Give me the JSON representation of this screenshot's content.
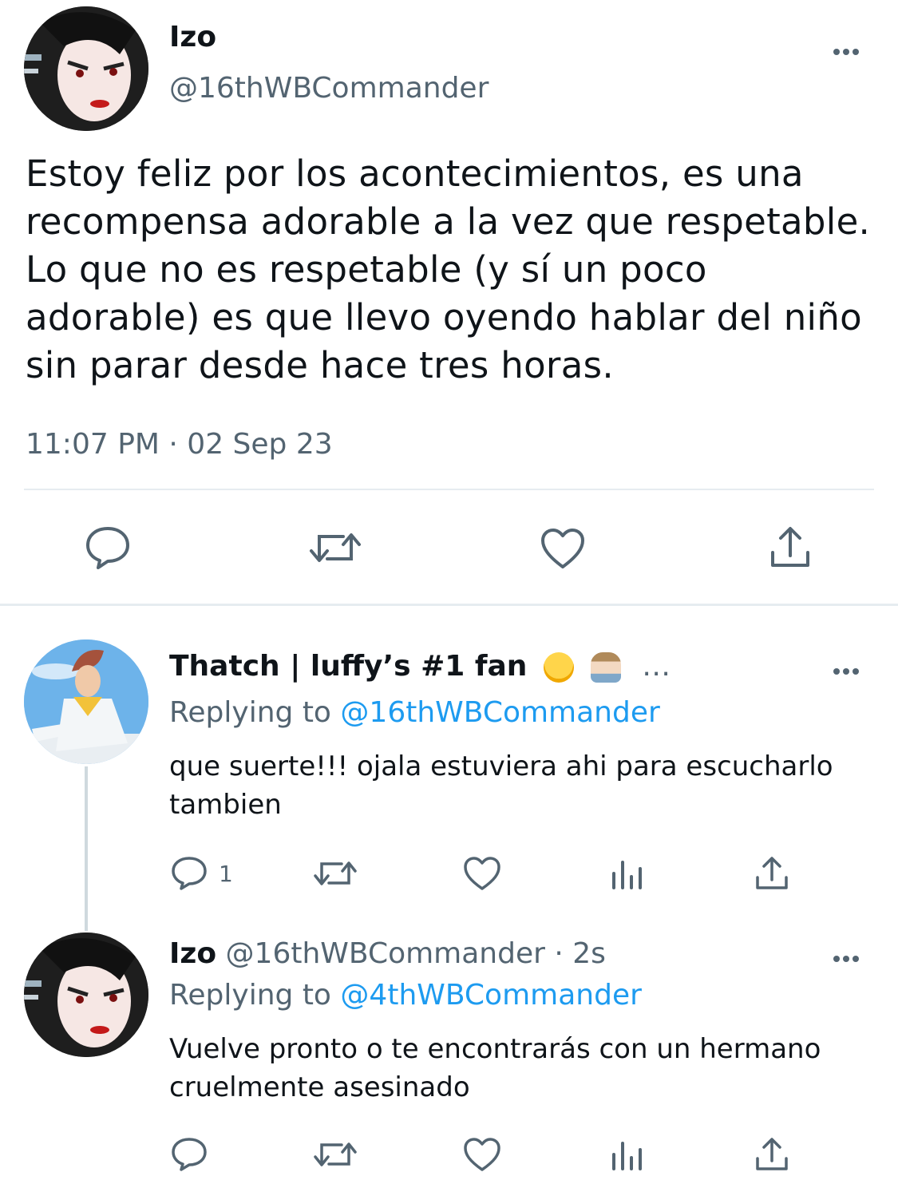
{
  "main_tweet": {
    "author_name": "Izo",
    "author_handle": "@16thWBCommander",
    "text": "Estoy feliz por los acontecimientos, es una recompensa adorable a la vez que respetable. Lo que no es respetable (y sí un poco adorable) es que llevo oyendo hablar del niño sin parar desde hace tres horas.",
    "timestamp": "11:07 PM · 02 Sep 23",
    "icons": [
      "reply-icon",
      "retweet-icon",
      "like-icon",
      "share-icon"
    ]
  },
  "replies": [
    {
      "author_name": "Thatch | luffy’s #1 fan",
      "name_suffix": "…",
      "replying_prefix": "Replying to",
      "replying_to": "@16thWBCommander",
      "text": "que suerte!!! ojala estuviera ahi para escucharlo tambien",
      "reply_count": "1",
      "icons": [
        "reply-icon",
        "retweet-icon",
        "like-icon",
        "views-icon",
        "share-icon"
      ]
    },
    {
      "author_name": "Izo",
      "author_handle": "@16thWBCommander",
      "time_ago": "· 2s",
      "replying_prefix": "Replying to",
      "replying_to": "@4thWBCommander",
      "text": "Vuelve pronto o te encontrarás con un hermano cruelmente asesinado",
      "icons": [
        "reply-icon",
        "retweet-icon",
        "like-icon",
        "views-icon",
        "share-icon"
      ]
    }
  ],
  "colors": {
    "text": "#0f1419",
    "secondary": "#536471",
    "link": "#1d9bf0",
    "divider": "#e6ecf0"
  }
}
